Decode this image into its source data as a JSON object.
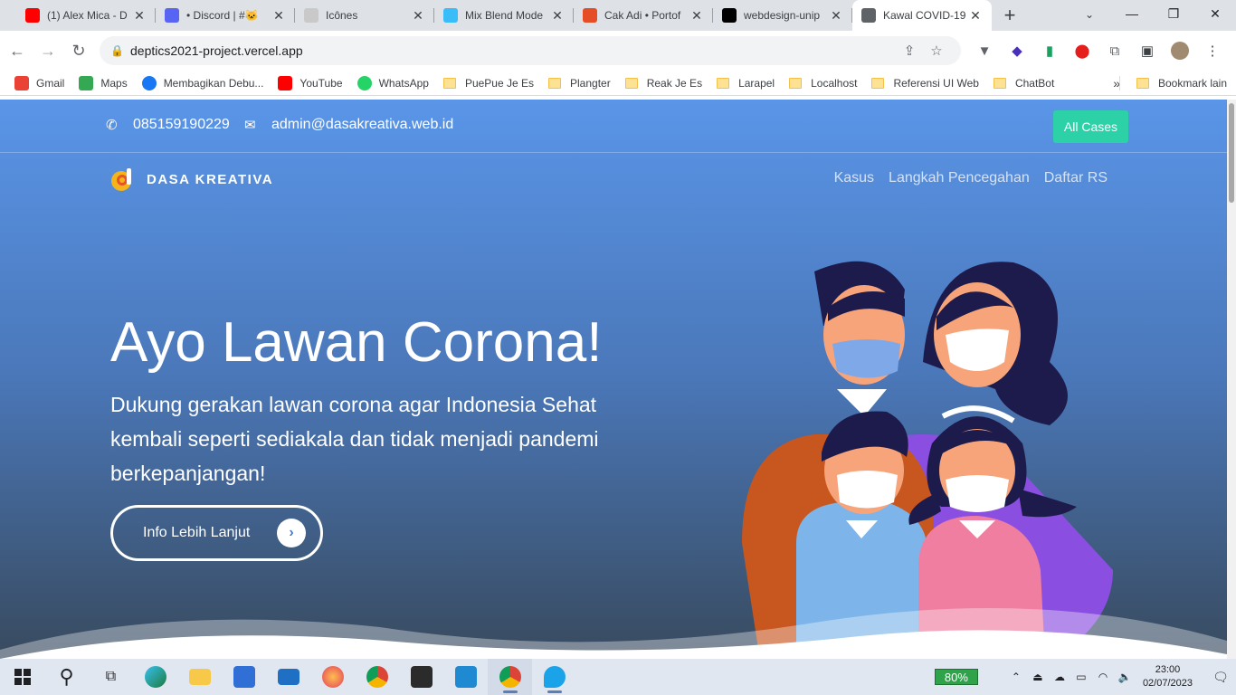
{
  "tabs": [
    {
      "title": "(1) Alex Mica - D",
      "icon": "youtube-icon",
      "color": "#ff0000"
    },
    {
      "title": "• Discord | #🐱",
      "icon": "discord-icon",
      "color": "#5865f2"
    },
    {
      "title": "Icônes",
      "icon": "icones-icon",
      "color": "#c9c9c9"
    },
    {
      "title": "Mix Blend Mode",
      "icon": "tailwind-icon",
      "color": "#38bdf8"
    },
    {
      "title": "Cak Adi • Portof",
      "icon": "portfolio-icon",
      "color": "#e44d26"
    },
    {
      "title": "webdesign-unip",
      "icon": "vercel-icon",
      "color": "#000000"
    },
    {
      "title": "Kawal COVID-19",
      "icon": "globe-icon",
      "color": "#5f6368"
    }
  ],
  "address_bar": {
    "url": "deptics2021-project.vercel.app"
  },
  "bookmarks": [
    {
      "label": "Gmail",
      "type": "gmail"
    },
    {
      "label": "Maps",
      "type": "maps"
    },
    {
      "label": "Membagikan Debu...",
      "type": "facebook"
    },
    {
      "label": "YouTube",
      "type": "youtube"
    },
    {
      "label": "WhatsApp",
      "type": "whatsapp"
    },
    {
      "label": "PuePue Je Es",
      "type": "folder"
    },
    {
      "label": "Plangter",
      "type": "folder"
    },
    {
      "label": "Reak Je Es",
      "type": "folder"
    },
    {
      "label": "Larapel",
      "type": "folder"
    },
    {
      "label": "Localhost",
      "type": "folder"
    },
    {
      "label": "Referensi UI Web",
      "type": "folder"
    },
    {
      "label": "ChatBot",
      "type": "folder"
    }
  ],
  "bookmarks_more": "»",
  "bookmarks_other": "Bookmark lain",
  "site": {
    "phone": "085159190229",
    "email": "admin@dasakreativa.web.id",
    "all_cases": "All Cases",
    "brand": "DASA KREATIVA",
    "menu": [
      "Kasus",
      "Langkah Pencegahan",
      "Daftar RS"
    ],
    "hero_title": "Ayo Lawan Corona!",
    "hero_subtitle": "Dukung gerakan lawan corona agar Indonesia Sehat kembali seperti sediakala dan tidak menjadi pandemi berkepanjangan!",
    "cta_label": "Info Lebih Lanjut",
    "colors": {
      "accent": "#2dd1a8",
      "hero_top": "#5a95e8",
      "hero_bottom": "#384a5e"
    }
  },
  "taskbar": {
    "battery": "80%",
    "time": "23:00",
    "date": "02/07/2023"
  }
}
